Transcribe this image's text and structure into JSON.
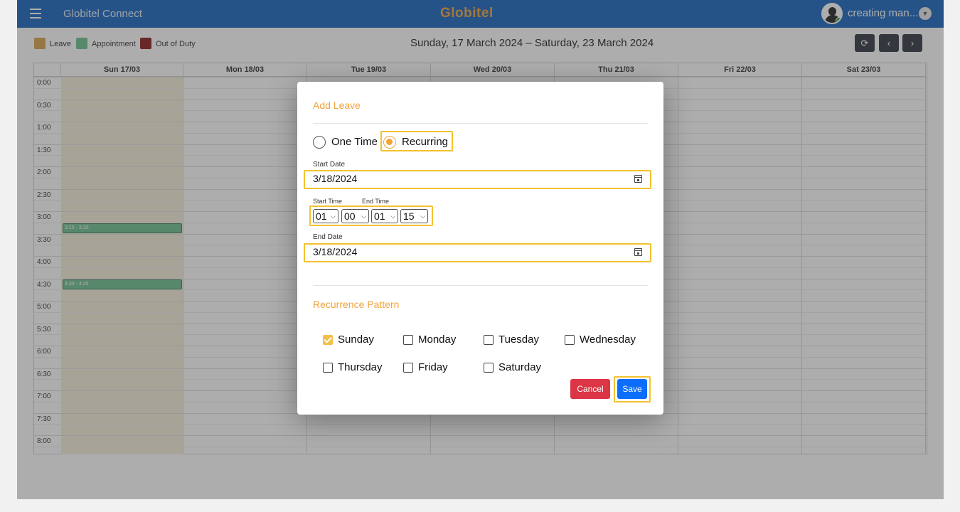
{
  "topbar": {
    "app_name": "Globitel Connect",
    "brand": "Globitel",
    "user_name": "creating man...",
    "menu_icon": "hamburger-icon",
    "user_caret_icon": "chevron-down-icon"
  },
  "legend": {
    "items": [
      {
        "label": "Leave",
        "color": "#d9a24a"
      },
      {
        "label": "Appointment",
        "color": "#6cbf8d"
      },
      {
        "label": "Out of Duty",
        "color": "#8b1a1a"
      }
    ]
  },
  "calendar": {
    "week_title": "Sunday, 17 March 2024 – Saturday, 23 March 2024",
    "nav": {
      "refresh": "⟳",
      "prev": "‹",
      "next": "›"
    },
    "days": [
      "Sun 17/03",
      "Mon 18/03",
      "Tue 19/03",
      "Wed 20/03",
      "Thu 21/03",
      "Fri 22/03",
      "Sat 23/03"
    ],
    "times": [
      "0:00",
      "0:30",
      "1:00",
      "1:30",
      "2:00",
      "2:30",
      "3:00",
      "3:30",
      "4:00",
      "4:30",
      "5:00",
      "5:30",
      "6:00",
      "6:30",
      "7:00",
      "7:30",
      "8:00"
    ],
    "events": [
      {
        "label": "3:15 - 3:30",
        "day": "Sun 17/03",
        "type": "Appointment"
      },
      {
        "label": "4:30 - 4:45",
        "day": "Sun 17/03",
        "type": "Appointment"
      }
    ]
  },
  "modal": {
    "title": "Add Leave",
    "mode_options": [
      {
        "label": "One Time",
        "selected": false
      },
      {
        "label": "Recurring",
        "selected": true
      }
    ],
    "start_date_label": "Start Date",
    "start_date": "3/18/2024",
    "start_time_label": "Start Time",
    "end_time_label": "End Time",
    "start_hour": "01",
    "start_minute": "00",
    "end_hour": "01",
    "end_minute": "15",
    "end_date_label": "End Date",
    "end_date": "3/18/2024",
    "recurrence_title": "Recurrence Pattern",
    "weekdays": [
      {
        "label": "Sunday",
        "checked": true
      },
      {
        "label": "Monday",
        "checked": false
      },
      {
        "label": "Tuesday",
        "checked": false
      },
      {
        "label": "Wednesday",
        "checked": false
      },
      {
        "label": "Thursday",
        "checked": false
      },
      {
        "label": "Friday",
        "checked": false
      },
      {
        "label": "Saturday",
        "checked": false
      }
    ],
    "cancel_label": "Cancel",
    "save_label": "Save"
  },
  "colors": {
    "topbar": "#1565c0",
    "accent": "#f2a33a",
    "highlight": "#f2c12e",
    "cancel": "#dc3545",
    "save": "#0d6efd"
  }
}
